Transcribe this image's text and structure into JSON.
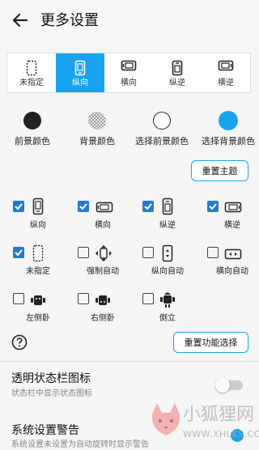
{
  "header": {
    "title": "更多设置"
  },
  "orientation_bar": {
    "items": [
      {
        "label": "未指定",
        "icon": "dashed-phone-icon",
        "active": false
      },
      {
        "label": "纵向",
        "icon": "portrait-phone-icon",
        "active": true
      },
      {
        "label": "横向",
        "icon": "landscape-phone-icon",
        "active": false
      },
      {
        "label": "纵逆",
        "icon": "reverse-portrait-phone-icon",
        "active": false
      },
      {
        "label": "横逆",
        "icon": "reverse-landscape-phone-icon",
        "active": false
      }
    ]
  },
  "colors": {
    "items": [
      {
        "label": "前景颜色",
        "color": "#222222"
      },
      {
        "label": "背景颜色",
        "color": "checkerboard"
      },
      {
        "label": "选择前景颜色",
        "color": "#ffffff"
      },
      {
        "label": "选择背景颜色",
        "color": "#19a3ef"
      }
    ],
    "reset_theme": "重置主题"
  },
  "functions": {
    "items": [
      {
        "label": "纵向",
        "checked": true,
        "icon": "portrait-phone-icon"
      },
      {
        "label": "横向",
        "checked": true,
        "icon": "landscape-phone-icon"
      },
      {
        "label": "纵逆",
        "checked": true,
        "icon": "reverse-portrait-phone-icon"
      },
      {
        "label": "横逆",
        "checked": true,
        "icon": "reverse-landscape-phone-icon"
      },
      {
        "label": "未指定",
        "checked": true,
        "icon": "dashed-phone-icon"
      },
      {
        "label": "强制自动",
        "checked": false,
        "icon": "rotate-arrows-icon"
      },
      {
        "label": "纵向自动",
        "checked": false,
        "icon": "portrait-auto-icon"
      },
      {
        "label": "横向自动",
        "checked": false,
        "icon": "landscape-auto-icon"
      },
      {
        "label": "左侧卧",
        "checked": false,
        "icon": "robot-left-icon"
      },
      {
        "label": "右侧卧",
        "checked": false,
        "icon": "robot-right-icon"
      },
      {
        "label": "倒立",
        "checked": false,
        "icon": "robot-upside-down-icon"
      }
    ],
    "reset_functions": "重置功能选择",
    "help_icon": "question-circle-icon"
  },
  "settings": {
    "statusbar_title": "透明状态栏图标",
    "statusbar_sub": "状态栏中显示状态图标",
    "statusbar_enabled": false,
    "warning_title": "系统设置警告",
    "warning_sub": "系统设置未设置为自动旋转时显示警告",
    "warning_enabled": true
  },
  "watermark": {
    "text": "小狐狸网",
    "url": "WWW.XHLKS.COM"
  },
  "theme": {
    "accent": "#19a3ef",
    "checkbox": "#2979c9"
  }
}
